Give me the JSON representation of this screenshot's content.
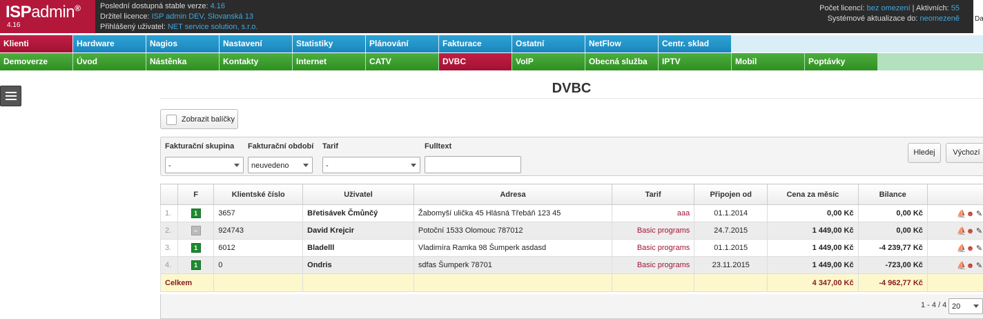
{
  "header": {
    "logo_main": "ISP",
    "logo_sub": "admin",
    "logo_reg": "®",
    "version": "4.16",
    "stable_label": "Poslední dostupná stable verze:",
    "stable_value": "4.16",
    "holder_label": "Držitel licence:",
    "holder_value": "ISP admin DEV, Slovanská 13",
    "user_label": "Přihlášený uživatel:",
    "user_value": "NET service solution, s.r.o.",
    "licenses_label": "Počet licencí:",
    "licenses_value": "bez omezení",
    "active_label": "Aktivních:",
    "active_value": "55",
    "updates_label": "Systémové aktualizace do:",
    "updates_value": "neomezeně",
    "corner_text": "Da"
  },
  "menu1": [
    "Klienti",
    "Hardware",
    "Nagios",
    "Nastavení",
    "Statistiky",
    "Plánování",
    "Fakturace",
    "Ostatní",
    "NetFlow",
    "Centr. sklad"
  ],
  "menu2": [
    "Demoverze",
    "Úvod",
    "Nástěnka",
    "Kontakty",
    "Internet",
    "CATV",
    "DVBC",
    "VoIP",
    "Obecná služba",
    "IPTV",
    "Mobil",
    "Poptávky"
  ],
  "page": {
    "title": "DVBC",
    "show_packages_label": "Zobrazit balíčky"
  },
  "filter": {
    "group_label": "Fakturační skupina",
    "group_value": "-",
    "period_label": "Fakturační období",
    "period_value": "neuvedeno",
    "tarif_label": "Tarif",
    "tarif_value": "-",
    "fulltext_label": "Fulltext",
    "fulltext_value": "",
    "search_button": "Hledej",
    "default_button": "Výchozí"
  },
  "table": {
    "columns": [
      "",
      "F",
      "Klientské číslo",
      "Uživatel",
      "Adresa",
      "Tarif",
      "Připojen od",
      "Cena za měsíc",
      "Bilance",
      ""
    ],
    "rows": [
      {
        "num": "1.",
        "flag": "1",
        "client_no": "3657",
        "user": "Břetisávek Čmůnčý",
        "address": "Žabomyší ulička 45 Hlásná Třebáň 123 45",
        "tarif": "aaa",
        "since": "01.1.2014",
        "price": "0,00 Kč",
        "balance": "0,00 Kč"
      },
      {
        "num": "2.",
        "flag": "–",
        "client_no": "924743",
        "user": "David Krejcir",
        "address": "Potoční 1533 Olomouc 787012",
        "tarif": "Basic programs",
        "since": "24.7.2015",
        "price": "1 449,00 Kč",
        "balance": "0,00 Kč"
      },
      {
        "num": "3.",
        "flag": "1",
        "client_no": "6012",
        "user": "Bladelll",
        "address": "Vladimíra Ramka 98 Šumperk asdasd",
        "tarif": "Basic programs",
        "since": "01.1.2015",
        "price": "1 449,00 Kč",
        "balance": "-4 239,77 Kč"
      },
      {
        "num": "4.",
        "flag": "1",
        "client_no": "0",
        "user": "Ondris",
        "address": "sdfas Šumperk 78701",
        "tarif": "Basic programs",
        "since": "23.11.2015",
        "price": "1 449,00 Kč",
        "balance": "-723,00 Kč"
      }
    ],
    "total_label": "Celkem",
    "total_price": "4 347,00 Kč",
    "total_balance": "-4 962,77 Kč"
  },
  "pager": {
    "info": "1 - 4 / 4",
    "per_page": "20"
  }
}
